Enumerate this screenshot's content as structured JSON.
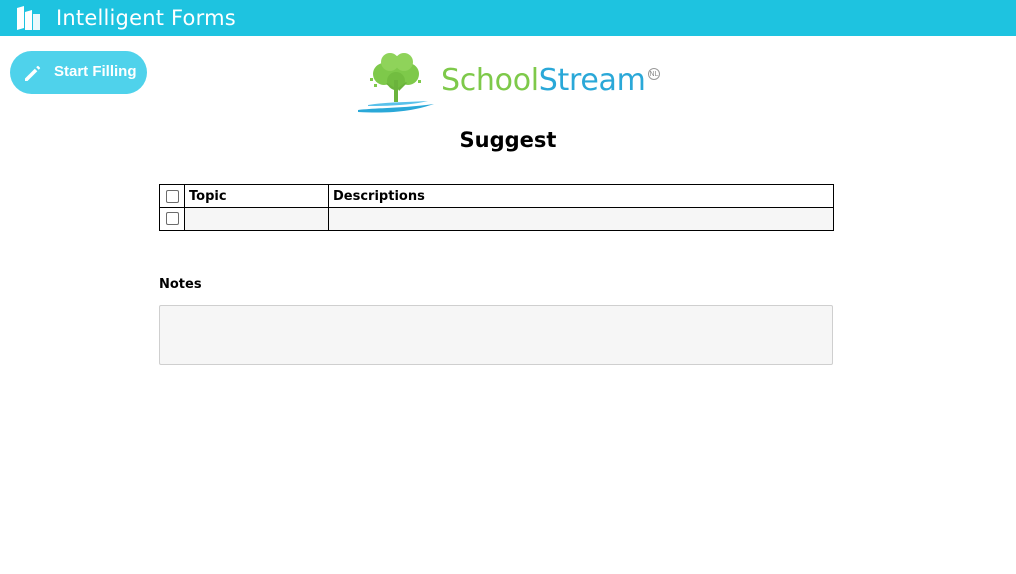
{
  "app": {
    "title": "Intelligent Forms",
    "accent_color": "#1ec3e0",
    "logo_icon": "book-logo-icon"
  },
  "toolbar": {
    "start_filling_label": "Start Filling",
    "start_filling_icon": "pencil-icon",
    "button_color": "#4fd2eb"
  },
  "brand": {
    "name_part1": "School",
    "name_part2": "Stream",
    "mark": "NL",
    "logo_icon": "tree-river-icon",
    "colors": {
      "school": "#7ec94a",
      "stream": "#2aa8d8"
    }
  },
  "form": {
    "title": "Suggest",
    "table": {
      "columns": [
        "Topic",
        "Descriptions"
      ],
      "rows": [
        {
          "topic": "",
          "description": ""
        }
      ]
    },
    "notes": {
      "label": "Notes",
      "value": ""
    }
  }
}
